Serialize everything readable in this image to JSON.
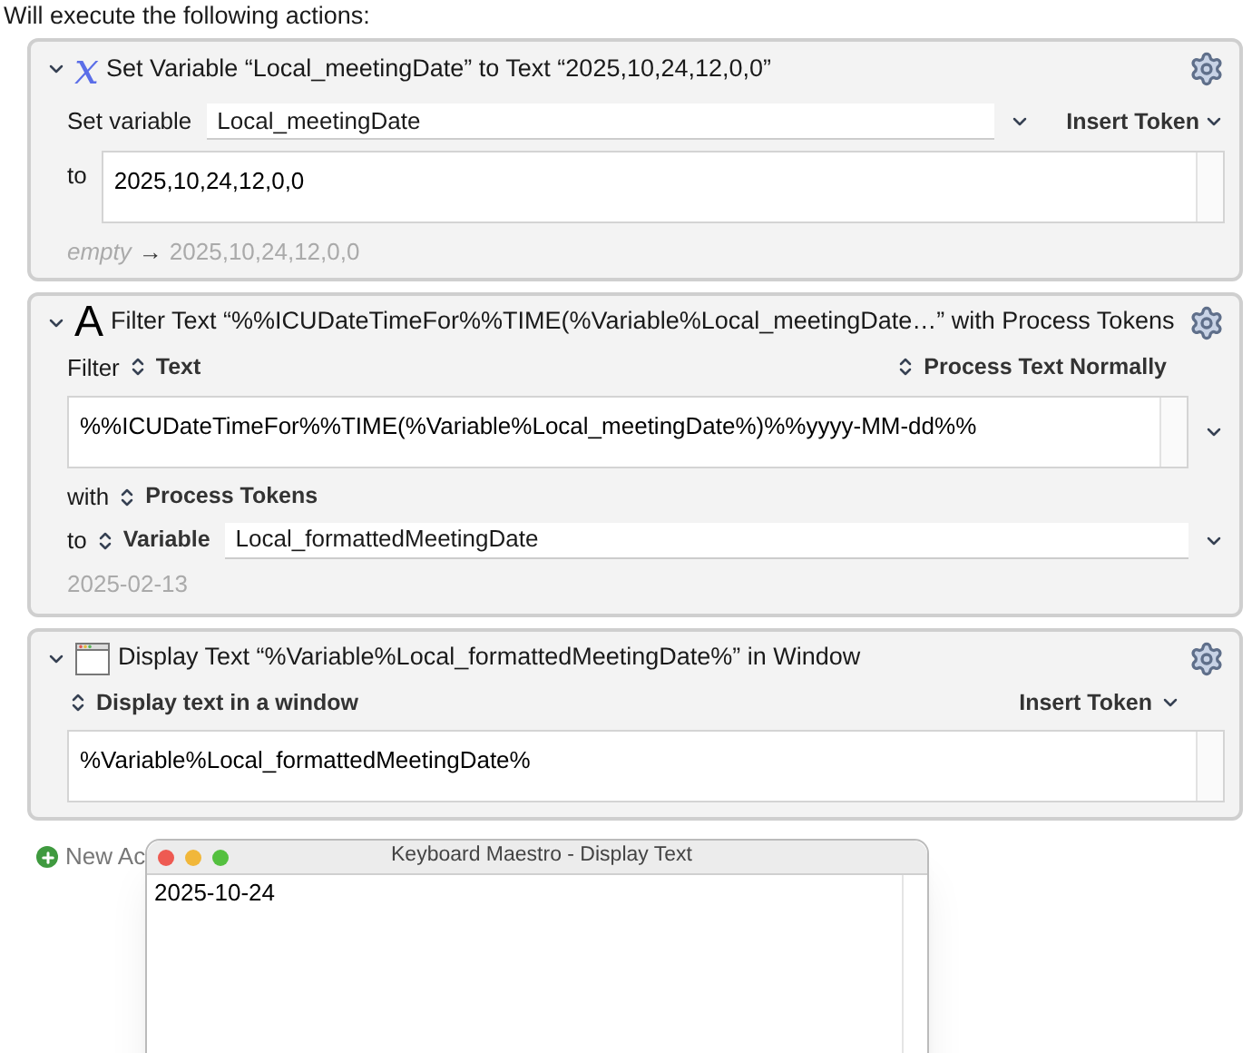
{
  "heading": "Will execute the following actions:",
  "actions": [
    {
      "kind": "set_variable",
      "icon": "x",
      "title": "Set Variable “Local_meetingDate” to Text “2025,10,24,12,0,0”",
      "variable_label": "Set variable",
      "variable": "Local_meetingDate",
      "insert_token": "Insert Token",
      "to_label": "to",
      "text": "2025,10,24,12,0,0",
      "result_prefix": "empty",
      "result_arrow": "→",
      "result": "2025,10,24,12,0,0"
    },
    {
      "kind": "filter_text",
      "icon": "A",
      "title": "Filter Text “%%ICUDateTimeFor%%TIME(%Variable%Local_meetingDate…” with Process Tokens",
      "filter_label": "Filter",
      "filter_source": "Text",
      "mode": "Process Text Normally",
      "text": "%%ICUDateTimeFor%%TIME(%Variable%Local_meetingDate%)%%yyyy-MM-dd%%",
      "with_label": "with",
      "process": "Process Tokens",
      "to_label": "to",
      "destination": "Variable",
      "variable": "Local_formattedMeetingDate",
      "result": "2025-02-13"
    },
    {
      "kind": "display_text",
      "title": "Display Text “%Variable%Local_formattedMeetingDate%” in Window",
      "display_mode": "Display text in a window",
      "insert_token": "Insert Token",
      "text": "%Variable%Local_formattedMeetingDate%"
    }
  ],
  "new_action": "New Ac",
  "popup": {
    "title": "Keyboard Maestro - Display Text",
    "text": "2025-10-24"
  }
}
